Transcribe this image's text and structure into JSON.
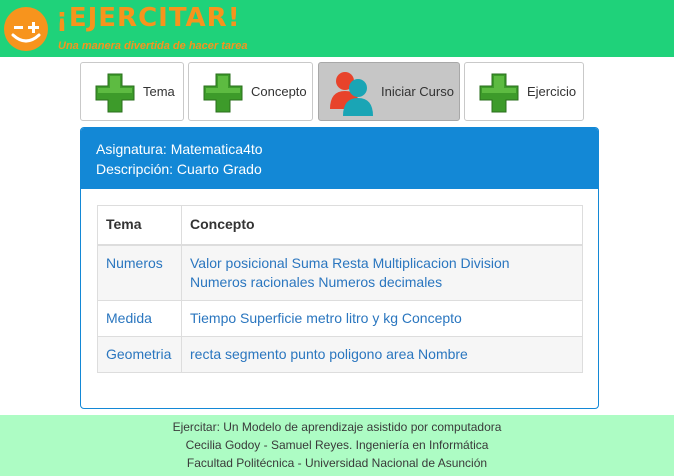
{
  "header": {
    "title": "¡EJERCITAR!",
    "tagline": "Una manera divertida de hacer tarea",
    "logo_icon": "smiley-face-icon",
    "brand_color": "#f7941d",
    "bar_color": "#1fd27a"
  },
  "nav": {
    "tema": {
      "label": "Tema",
      "icon": "plus-icon"
    },
    "concepto": {
      "label": "Concepto",
      "icon": "plus-icon"
    },
    "iniciar": {
      "label": "Iniciar Curso",
      "icon": "users-icon",
      "active": true
    },
    "ejercicio": {
      "label": "Ejercicio",
      "icon": "plus-icon"
    }
  },
  "panel": {
    "asignatura": "Asignatura: Matematica4to",
    "descripcion": "Descripción: Cuarto Grado",
    "accent_color": "#1388d6"
  },
  "table": {
    "headers": [
      "Tema",
      "Concepto"
    ],
    "rows": [
      {
        "tema": "Numeros",
        "concepto_line1": "Valor posicional Suma Resta Multiplicacion Division",
        "concepto_line2": "Numeros racionales Numeros decimales"
      },
      {
        "tema": "Medida",
        "concepto": "Tiempo Superficie metro litro y kg Concepto"
      },
      {
        "tema": "Geometria",
        "concepto": "recta segmento punto poligono area Nombre"
      }
    ]
  },
  "footer": {
    "line1": "Ejercitar: Un Modelo de aprendizaje asistido por computadora",
    "line2": "Cecilia Godoy - Samuel Reyes. Ingeniería en Informática",
    "line3": "Facultad Politécnica - Universidad Nacional de Asunción"
  }
}
